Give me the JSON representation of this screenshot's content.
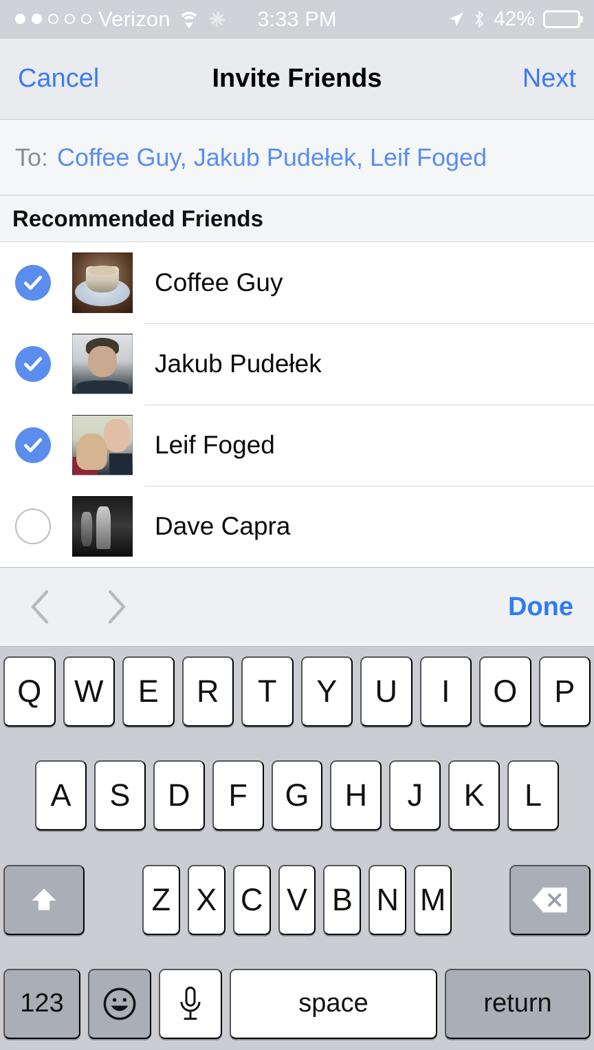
{
  "status_bar": {
    "signal_dots": [
      true,
      true,
      false,
      false,
      false
    ],
    "carrier": "Verizon",
    "wifi_icon": "wifi-icon",
    "activity_icon": "activity-spinner-icon",
    "time": "3:33 PM",
    "location_icon": "location-arrow-icon",
    "bluetooth_icon": "bluetooth-icon",
    "battery_percent": "42%",
    "battery_level": 42
  },
  "nav_bar": {
    "cancel_label": "Cancel",
    "title": "Invite Friends",
    "next_label": "Next",
    "accent_color": "#3b7af7"
  },
  "to_field": {
    "label": "To:",
    "recipients_text": "Coffee Guy, Jakub Pudełek, Leif Foged",
    "recipients": [
      "Coffee Guy",
      "Jakub Pudełek",
      "Leif Foged"
    ],
    "recipient_color": "#5a8df0"
  },
  "section": {
    "header": "Recommended Friends"
  },
  "friends": [
    {
      "name": "Coffee Guy",
      "selected": true,
      "avatar": "coffee-cup-photo"
    },
    {
      "name": "Jakub Pudełek",
      "selected": true,
      "avatar": "man-portrait-photo"
    },
    {
      "name": "Leif Foged",
      "selected": true,
      "avatar": "man-with-cat-photo"
    },
    {
      "name": "Dave Capra",
      "selected": false,
      "avatar": "black-and-white-street-photo"
    }
  ],
  "selection_color": "#5b8def",
  "keyboard_toolbar": {
    "prev_icon": "chevron-left-icon",
    "next_icon": "chevron-right-icon",
    "prev_enabled": false,
    "next_enabled": false,
    "done_label": "Done",
    "done_color": "#2f7bf6"
  },
  "keyboard": {
    "shift_state": "on",
    "row1": [
      "Q",
      "W",
      "E",
      "R",
      "T",
      "Y",
      "U",
      "I",
      "O",
      "P"
    ],
    "row2": [
      "A",
      "S",
      "D",
      "F",
      "G",
      "H",
      "J",
      "K",
      "L"
    ],
    "row3": [
      "Z",
      "X",
      "C",
      "V",
      "B",
      "N",
      "M"
    ],
    "shift_icon": "shift-up-arrow-icon",
    "delete_icon": "backspace-delete-icon",
    "numbers_label": "123",
    "emoji_icon": "emoji-smiley-icon",
    "dictation_icon": "microphone-icon",
    "space_label": "space",
    "return_label": "return"
  }
}
